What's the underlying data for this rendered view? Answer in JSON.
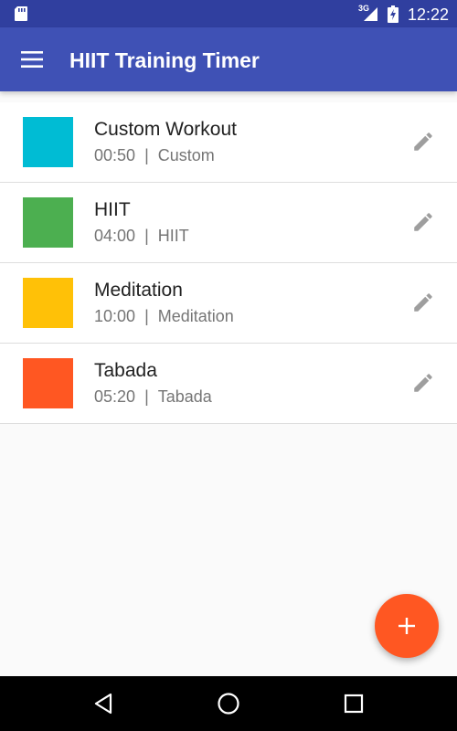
{
  "status_bar": {
    "time": "12:22",
    "network_type": "3G",
    "icons": [
      "sd-card-icon",
      "signal-icon",
      "battery-charging-icon"
    ]
  },
  "app_bar": {
    "title": "HIIT Training Timer",
    "menu_icon": "hamburger-menu-icon"
  },
  "workouts": [
    {
      "name": "Custom Workout",
      "duration": "00:50",
      "separator": "|",
      "type": "Custom",
      "color": "#00bcd4",
      "edit_icon": "pencil-icon"
    },
    {
      "name": "HIIT",
      "duration": "04:00",
      "separator": "|",
      "type": "HIIT",
      "color": "#4caf50",
      "edit_icon": "pencil-icon"
    },
    {
      "name": "Meditation",
      "duration": "10:00",
      "separator": "|",
      "type": "Meditation",
      "color": "#ffc107",
      "edit_icon": "pencil-icon"
    },
    {
      "name": "Tabada",
      "duration": "05:20",
      "separator": "|",
      "type": "Tabada",
      "color": "#ff5722",
      "edit_icon": "pencil-icon"
    }
  ],
  "fab": {
    "icon": "plus-icon",
    "color": "#ff5722"
  },
  "nav_bar": {
    "icons": [
      "back-triangle-icon",
      "home-circle-icon",
      "recents-square-icon"
    ]
  },
  "colors": {
    "status_bar": "#303f9f",
    "app_bar": "#3f51b5",
    "background": "#fafafa",
    "icon_gray": "#9e9e9e"
  }
}
